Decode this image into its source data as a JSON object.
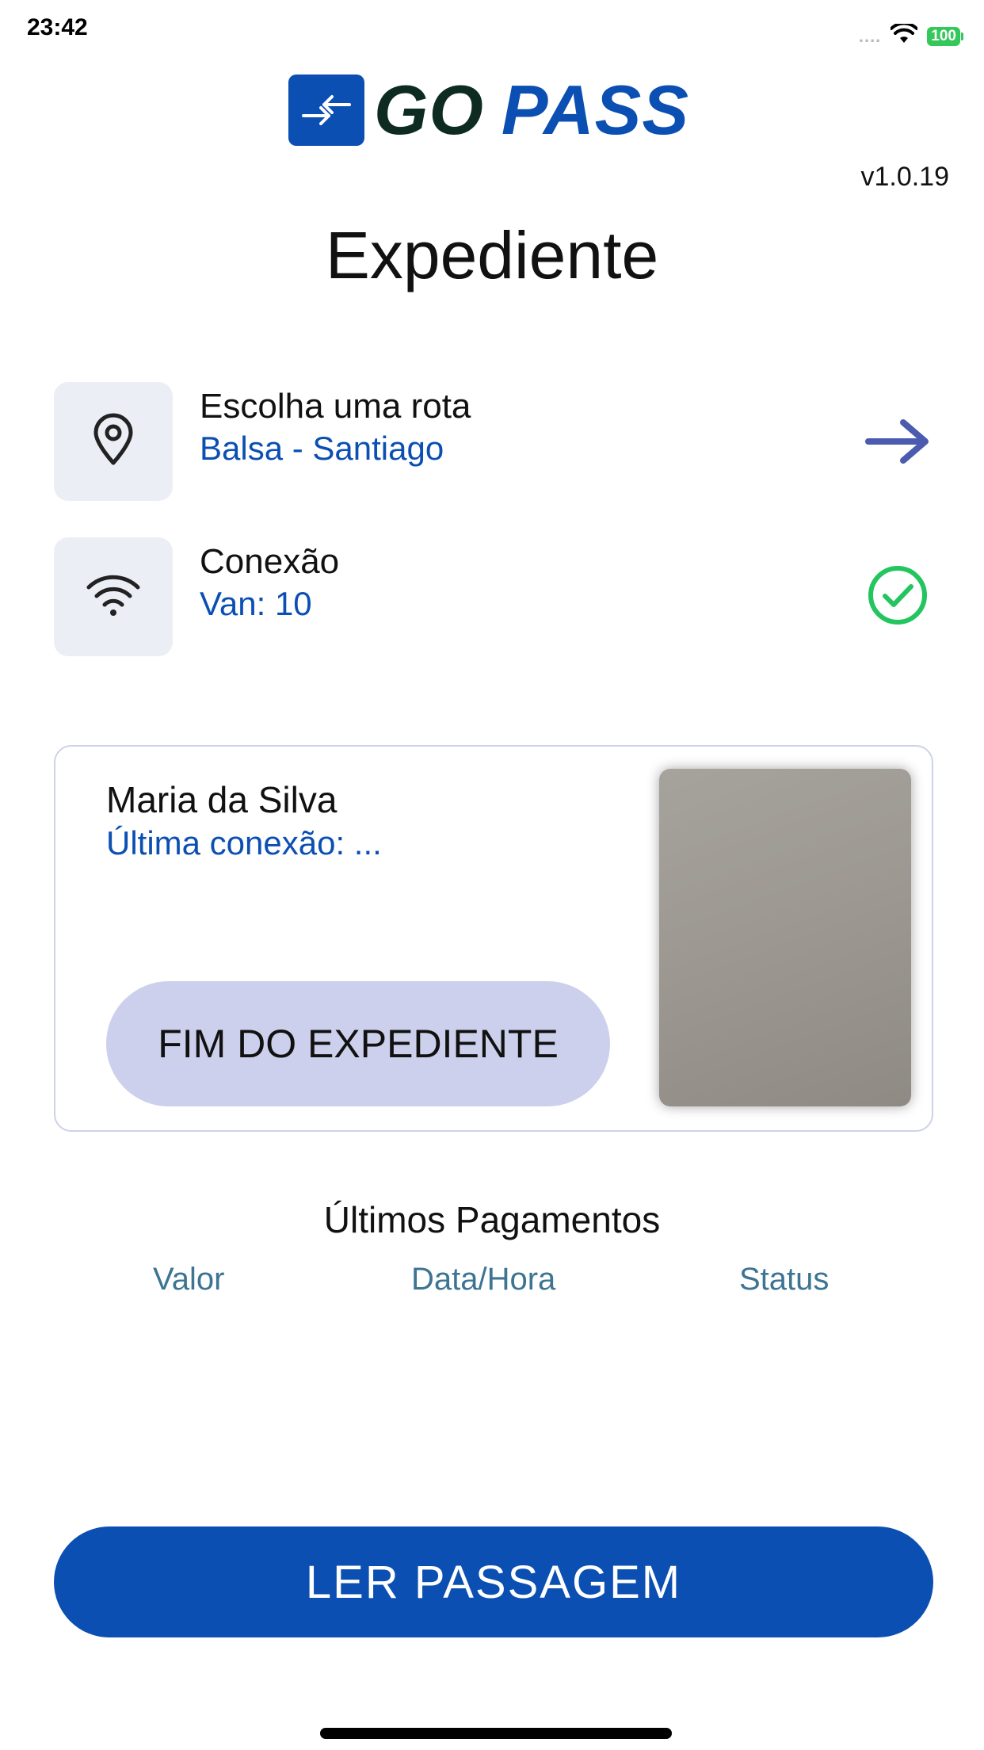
{
  "status_bar": {
    "time": "23:42",
    "signal": "....",
    "battery": "100"
  },
  "app": {
    "logo_word_1": "GO",
    "logo_word_2": "PASS",
    "version": "v1.0.19"
  },
  "page": {
    "title": "Expediente"
  },
  "route": {
    "label": "Escolha uma rota",
    "value": "Balsa - Santiago",
    "icon": "map-pin-icon",
    "action_icon": "arrow-right-icon"
  },
  "connection": {
    "label": "Conexão",
    "value": "Van: 10",
    "icon": "wifi-icon",
    "status_icon": "check-circle-icon"
  },
  "driver_card": {
    "name": "Maria da Silva",
    "last_connection": "Última conexão: ...",
    "end_shift_button": "FIM DO EXPEDIENTE"
  },
  "payments": {
    "title": "Últimos Pagamentos",
    "columns": [
      "Valor",
      "Data/Hora",
      "Status"
    ],
    "rows": []
  },
  "footer": {
    "read_ticket_button": "LER PASSAGEM"
  },
  "colors": {
    "primary": "#0b4fb3",
    "logo_dark": "#0e2b22",
    "success": "#22c55e",
    "accent_arrow": "#4a5bb0",
    "secondary_button": "#ccd0ec",
    "table_header": "#3c7492"
  }
}
